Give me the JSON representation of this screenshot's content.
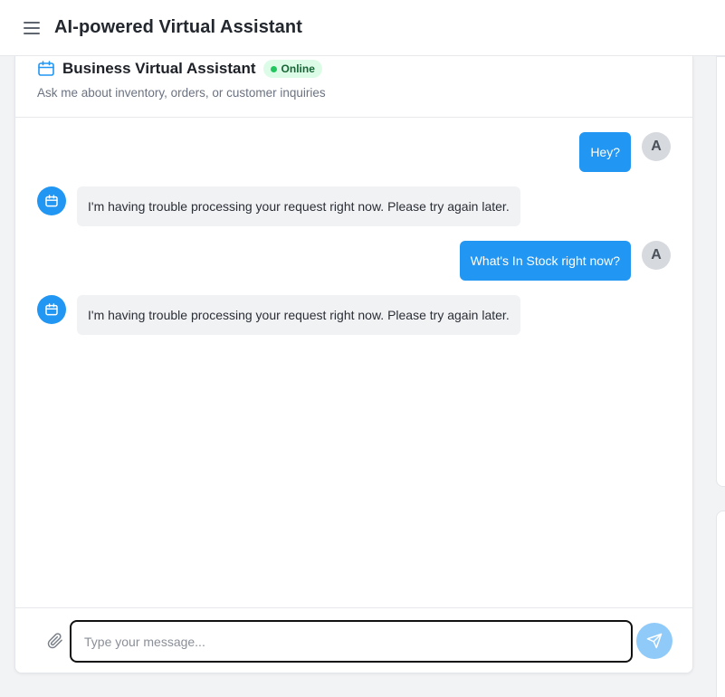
{
  "app": {
    "title": "AI-powered Virtual Assistant",
    "menu_icon": "hamburger-menu-icon"
  },
  "chat": {
    "assistant_name": "Business Virtual Assistant",
    "assistant_icon": "calendar-bot-icon",
    "status": "Online",
    "subtitle": "Ask me about inventory, orders, or customer inquiries"
  },
  "messages": [
    {
      "sender": "user",
      "avatar": "A",
      "text": "Hey?"
    },
    {
      "sender": "bot",
      "avatar_icon": "calendar-bot-icon",
      "text": "I'm having trouble processing your request right now. Please try again later."
    },
    {
      "sender": "user",
      "avatar": "A",
      "text": "What's In Stock right now?"
    },
    {
      "sender": "bot",
      "avatar_icon": "calendar-bot-icon",
      "text": "I'm having trouble processing your request right now. Please try again later."
    }
  ],
  "composer": {
    "placeholder": "Type your message...",
    "value": "",
    "attach_icon": "paperclip-icon",
    "send_icon": "send-icon"
  },
  "colors": {
    "accent": "#2196f3",
    "send_disabled": "#90caf9",
    "status_bg": "#dcfce7",
    "status_text": "#166534",
    "status_dot": "#22c55e"
  }
}
